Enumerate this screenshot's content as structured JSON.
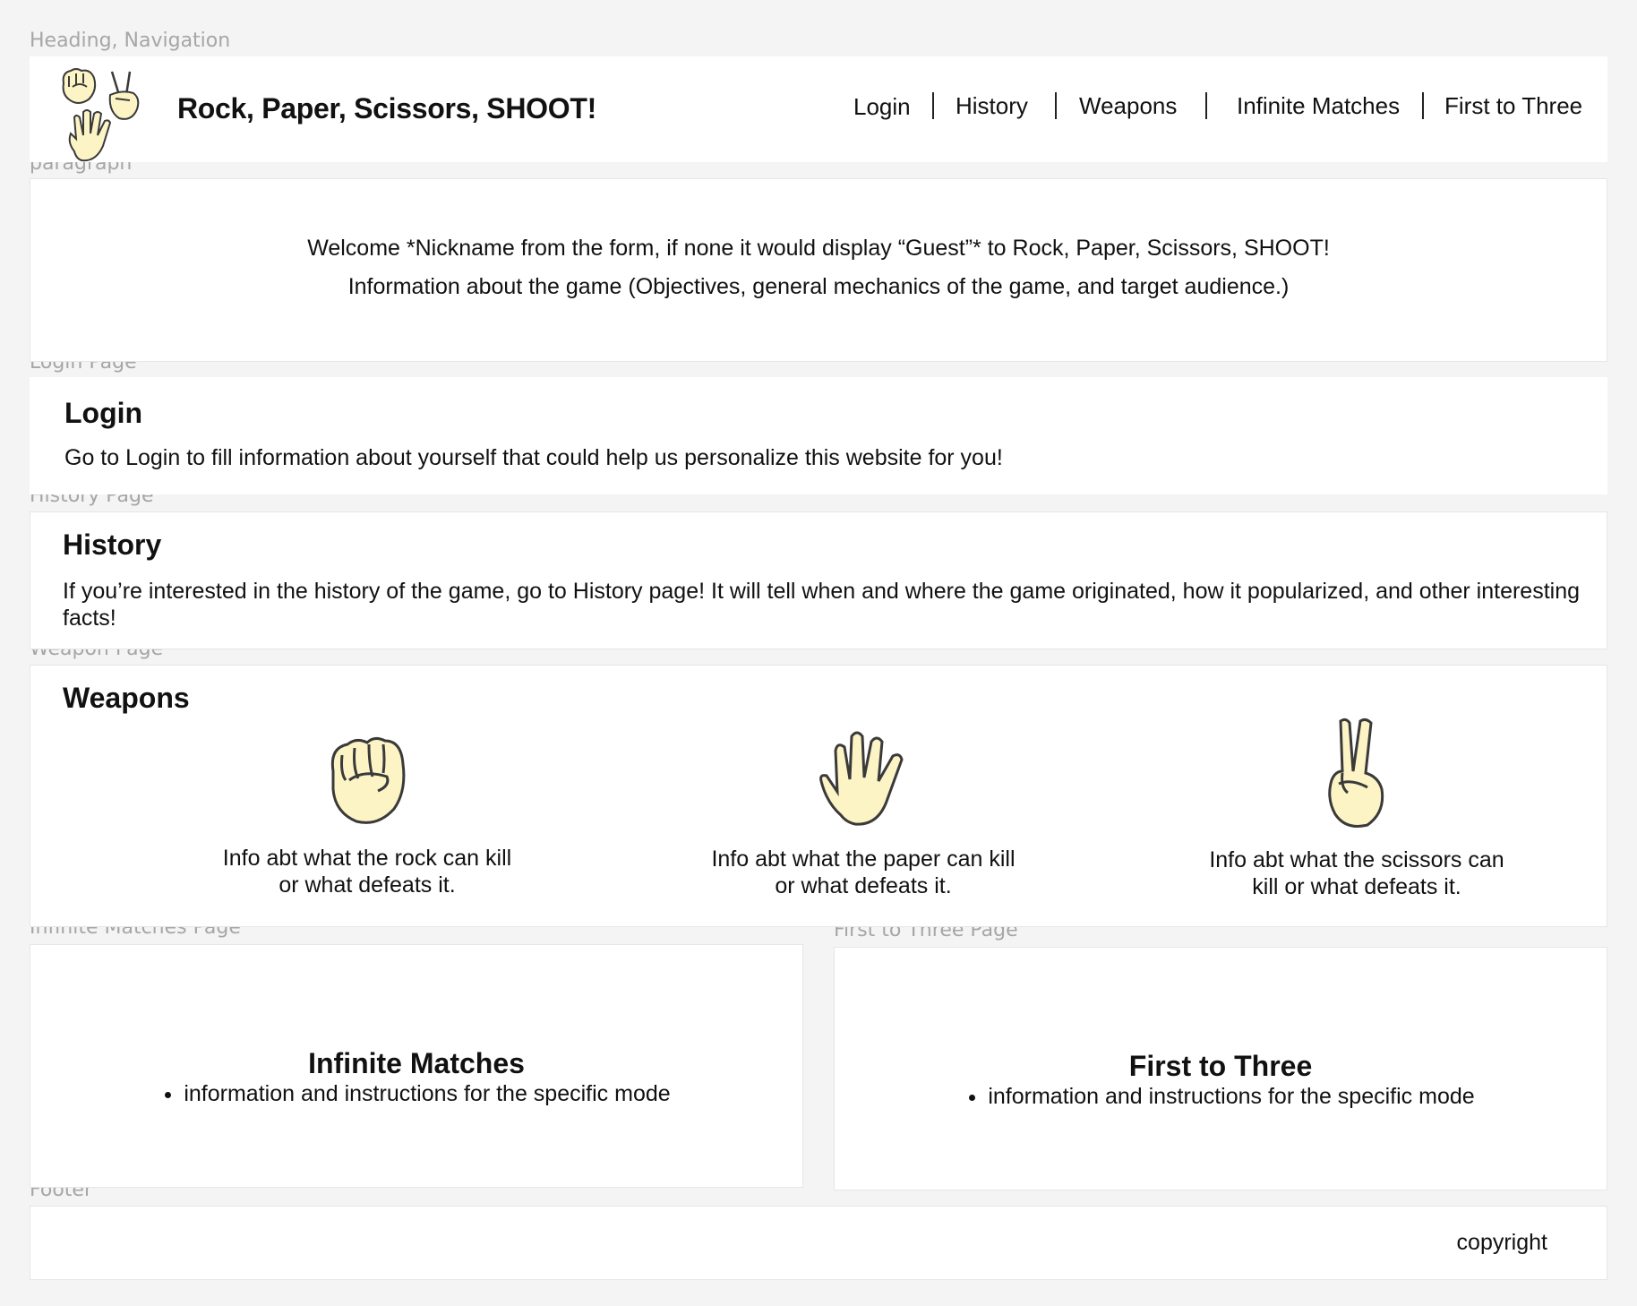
{
  "labels": {
    "header": "Heading, Navigation",
    "paragraph": "paragraph",
    "login": "Login Page",
    "history": "History Page",
    "weapon": "Weapon Page",
    "infinite": "Infinite Matches Page",
    "first_three": "First to Three Page",
    "footer": "Footer"
  },
  "header": {
    "title": "Rock, Paper, Scissors, SHOOT!",
    "nav": [
      "Login",
      "History",
      "Weapons",
      "Infinite Matches",
      "First to Three"
    ]
  },
  "welcome": {
    "line1": "Welcome *Nickname from the form, if none it would display “Guest”* to Rock, Paper, Scissors, SHOOT!",
    "line2": "Information about the game (Objectives, general mechanics of the game, and target audience.)"
  },
  "login": {
    "title": "Login",
    "text": "Go to Login to fill information about yourself that could help us personalize this website for you!"
  },
  "history": {
    "title": "History",
    "text": "If you’re interested in the history of the game, go to History page! It will tell when and where the game originated, how it popularized, and other interesting facts!"
  },
  "weapons": {
    "title": "Weapons",
    "items": [
      {
        "icon": "rock-fist-icon",
        "text": "Info abt what the rock can kill or what defeats it."
      },
      {
        "icon": "paper-hand-icon",
        "text": "Info abt what the paper can kill or what defeats it."
      },
      {
        "icon": "scissors-hand-icon",
        "text": "Info abt what the scissors can kill or what defeats it."
      }
    ]
  },
  "infinite": {
    "title": "Infinite Matches",
    "bullet": "information and instructions for the specific mode"
  },
  "first_three": {
    "title": "First to Three",
    "bullet": "information and instructions for the specific mode"
  },
  "footer": {
    "copyright": "copyright"
  },
  "colors": {
    "hand_fill": "#fdf4c6",
    "hand_stroke": "#3a3a3a",
    "background": "#f4f4f4",
    "label": "#a6a6a6"
  }
}
